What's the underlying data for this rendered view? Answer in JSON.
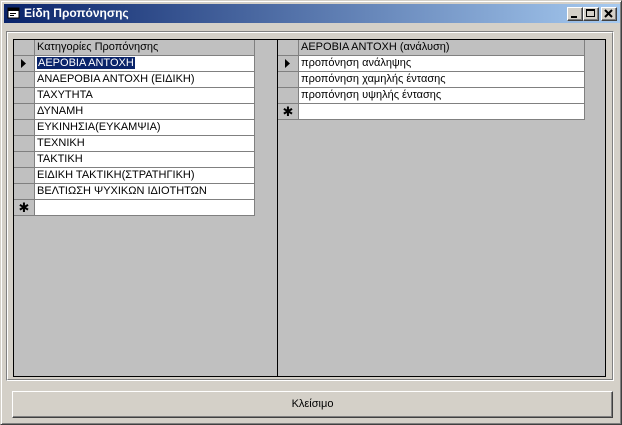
{
  "window": {
    "title": "Είδη Προπόνησης"
  },
  "left_grid": {
    "header": "Κατηγορίες Προπόνησης",
    "rows": [
      "ΑΕΡΟΒΙΑ ΑΝΤΟΧΗ",
      "ΑΝΑΕΡΟΒΙΑ ΑΝΤΟΧΗ (ΕΙΔΙΚΗ)",
      "ΤΑΧΥΤΗΤΑ",
      "ΔΥΝΑΜΗ",
      "ΕΥΚΙΝΗΣΙΑ(ΕΥΚΑΜΨΙΑ)",
      "ΤΕΧΝΙΚΗ",
      "ΤΑΚΤΙΚΗ",
      "ΕΙΔΙΚΗ ΤΑΚΤΙΚΗ(ΣΤΡΑΤΗΓΙΚΗ)",
      "ΒΕΛΤΙΩΣΗ ΨΥΧΙΚΩΝ ΙΔΙΟΤΗΤΩΝ"
    ]
  },
  "right_grid": {
    "header": "ΑΕΡΟΒΙΑ ΑΝΤΟΧΗ (ανάλυση)",
    "rows": [
      "προπόνηση ανάληψης",
      "προπόνηση χαμηλής έντασης",
      "προπόνηση υψηλής έντασης"
    ]
  },
  "new_row_marker": "✱",
  "buttons": {
    "close_label": "Κλείσιμο"
  }
}
